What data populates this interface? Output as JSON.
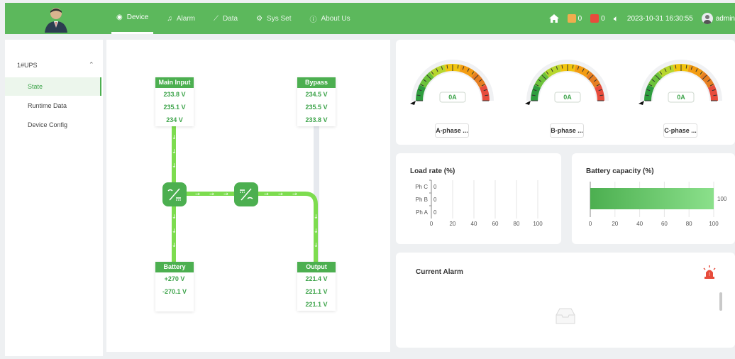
{
  "header": {
    "tabs": [
      {
        "label": "Device",
        "icon": "device-icon"
      },
      {
        "label": "Alarm",
        "icon": "alarm-icon"
      },
      {
        "label": "Data",
        "icon": "chart-icon"
      },
      {
        "label": "Sys Set",
        "icon": "gear-icon"
      },
      {
        "label": "About Us",
        "icon": "info-icon"
      }
    ],
    "alarm_count_1": "0",
    "alarm_count_2": "0",
    "datetime": "2023-10-31 16:30:55",
    "user": "admin"
  },
  "sidebar": {
    "group": "1#UPS",
    "items": [
      {
        "label": "State"
      },
      {
        "label": "Runtime Data"
      },
      {
        "label": "Device Config"
      }
    ]
  },
  "diagram": {
    "main_input": {
      "title": "Main Input",
      "values": [
        "233.8 V",
        "235.1 V",
        "234 V"
      ]
    },
    "bypass": {
      "title": "Bypass",
      "values": [
        "234.5 V",
        "235.5 V",
        "233.8 V"
      ]
    },
    "battery": {
      "title": "Battery",
      "values": [
        "+270 V",
        "-270.1 V"
      ]
    },
    "output": {
      "title": "Output",
      "values": [
        "221.4 V",
        "221.1 V",
        "221.1 V"
      ]
    }
  },
  "gauges": [
    {
      "label": "A-phase ...",
      "value": "0A"
    },
    {
      "label": "B-phase ...",
      "value": "0A"
    },
    {
      "label": "C-phase ...",
      "value": "0A"
    }
  ],
  "load_rate": {
    "title": "Load rate (%)",
    "chart_data": {
      "type": "bar",
      "categories": [
        "Ph C",
        "Ph B",
        "Ph A"
      ],
      "values": [
        0,
        0,
        0
      ],
      "xlim": [
        0,
        100
      ],
      "ticks": [
        "0",
        "20",
        "40",
        "60",
        "80",
        "100"
      ]
    }
  },
  "battery_capacity": {
    "title": "Battery capacity (%)",
    "chart_data": {
      "type": "bar",
      "values": [
        100
      ],
      "xlim": [
        0,
        100
      ],
      "ticks": [
        "0",
        "20",
        "40",
        "60",
        "80",
        "100"
      ]
    },
    "value_label": "100"
  },
  "alarm": {
    "title": "Current Alarm"
  },
  "colors": {
    "primary": "#5cb85c",
    "accent_text": "#3ea44b"
  }
}
